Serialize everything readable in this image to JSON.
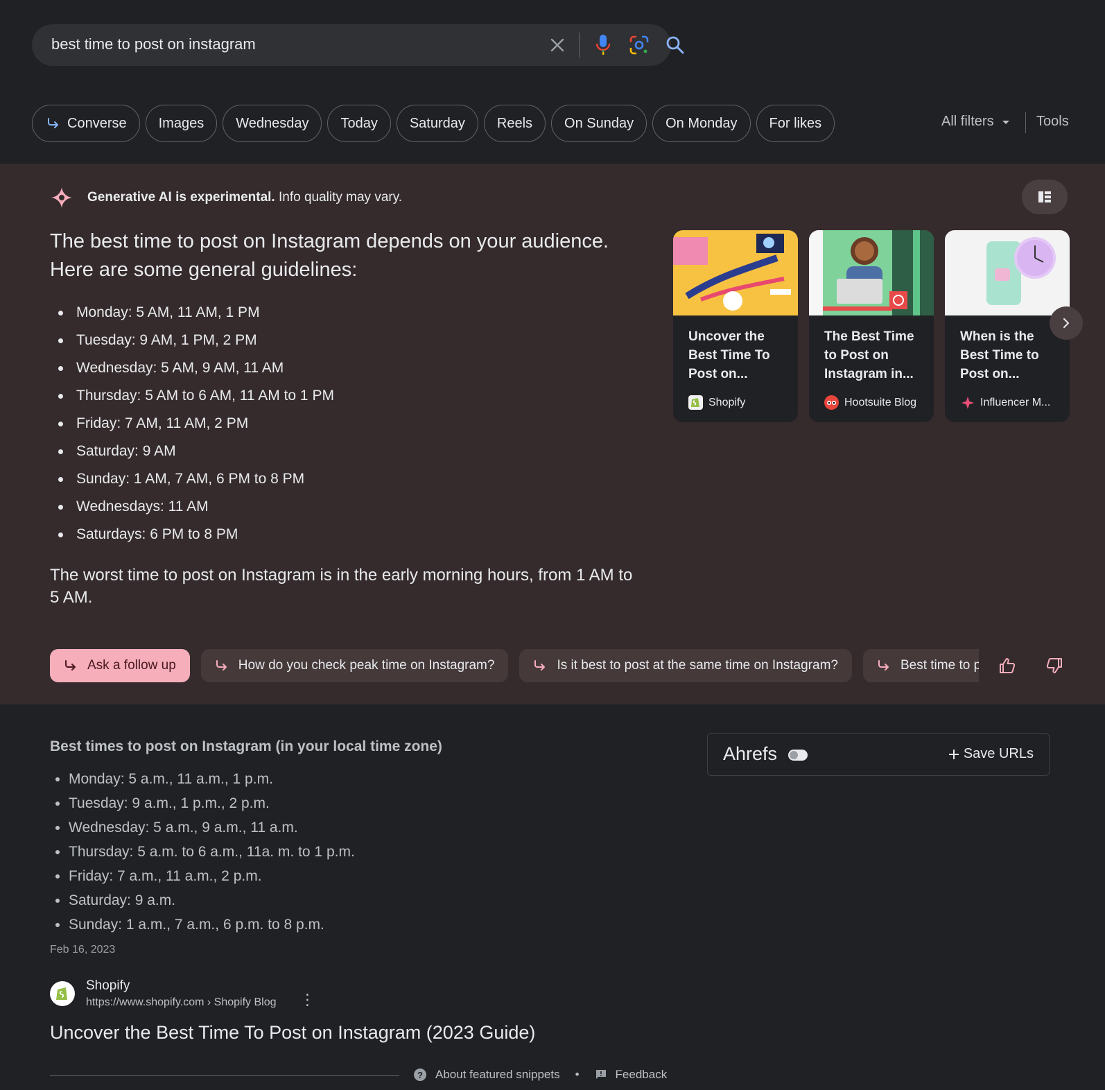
{
  "search": {
    "query": "best time to post on instagram"
  },
  "chips": [
    "Converse",
    "Images",
    "Wednesday",
    "Today",
    "Saturday",
    "Reels",
    "On Sunday",
    "On Monday",
    "For likes"
  ],
  "filters": {
    "all_filters": "All filters",
    "tools": "Tools"
  },
  "ai_overview": {
    "disclaimer_bold": "Generative AI is experimental.",
    "disclaimer_rest": " Info quality may vary.",
    "lead": "The best time to post on Instagram depends on your audience. Here are some general guidelines:",
    "items": [
      "Monday: 5 AM, 11 AM, 1 PM",
      "Tuesday: 9 AM, 1 PM, 2 PM",
      "Wednesday: 5 AM, 9 AM, 11 AM",
      "Thursday: 5 AM to 6 AM, 11 AM to 1 PM",
      "Friday: 7 AM, 11 AM, 2 PM",
      "Saturday: 9 AM",
      "Sunday: 1 AM, 7 AM, 6 PM to 8 PM",
      "Wednesdays: 11 AM",
      "Saturdays: 6 PM to 8 PM"
    ],
    "worst": "The worst time to post on Instagram is in the early morning hours, from 1 AM to 5 AM.",
    "cards": [
      {
        "title": "Uncover the Best Time To Post on...",
        "source": "Shopify"
      },
      {
        "title": "The Best Time to Post on Instagram in...",
        "source": "Hootsuite Blog"
      },
      {
        "title": "When is the Best Time to Post on...",
        "source": "Influencer M..."
      }
    ],
    "followups": [
      "Ask a follow up",
      "How do you check peak time on Instagram?",
      "Is it best to post at the same time on Instagram?",
      "Best time to post"
    ]
  },
  "snippet": {
    "title": "Best times to post on Instagram (in your local time zone)",
    "items": [
      "Monday: 5 a.m., 11 a.m., 1 p.m.",
      "Tuesday: 9 a.m., 1 p.m., 2 p.m.",
      "Wednesday: 5 a.m., 9 a.m., 11 a.m.",
      "Thursday: 5 a.m. to 6 a.m., 11a. m. to 1 p.m.",
      "Friday: 7 a.m., 11 a.m., 2 p.m.",
      "Saturday: 9 a.m.",
      "Sunday: 1 a.m., 7 a.m., 6 p.m. to 8 p.m."
    ],
    "date": "Feb 16, 2023",
    "source_name": "Shopify",
    "source_url": "https://www.shopify.com › Shopify Blog",
    "result_title": "Uncover the Best Time To Post on Instagram (2023 Guide)",
    "about": "About featured snippets",
    "feedback": "Feedback"
  },
  "ahrefs": {
    "brand": "Ahrefs",
    "save": "Save URLs"
  }
}
